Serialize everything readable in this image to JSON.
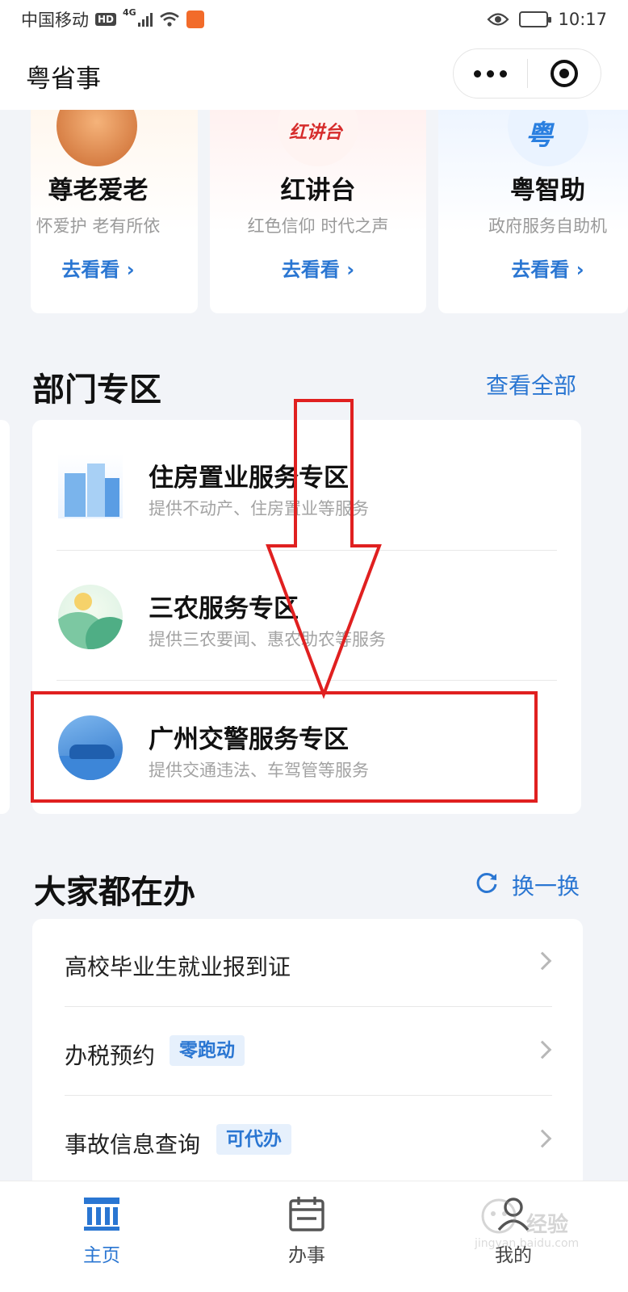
{
  "status_bar": {
    "carrier": "中国移动",
    "hd_badge": "HD",
    "network": "4G",
    "time": "10:17"
  },
  "app": {
    "title": "粤省事"
  },
  "feature_cards": [
    {
      "title": "尊老爱老",
      "subtitle": "怀爱护 老有所依",
      "link": "去看看 ›"
    },
    {
      "title": "红讲台",
      "subtitle": "红色信仰 时代之声",
      "link": "去看看 ›",
      "logo_text": "红讲台"
    },
    {
      "title": "粤智助",
      "subtitle": "政府服务自助机",
      "link": "去看看 ›",
      "logo_text": "粤"
    }
  ],
  "department": {
    "title": "部门专区",
    "view_all": "查看全部",
    "items": [
      {
        "title": "住房置业服务专区",
        "subtitle": "提供不动产、住房置业等服务",
        "icon": "house-building-icon"
      },
      {
        "title": "三农服务专区",
        "subtitle": "提供三农要闻、惠农助农等服务",
        "icon": "farm-landscape-icon"
      },
      {
        "title": "广州交警服务专区",
        "subtitle": "提供交通违法、车驾管等服务",
        "icon": "traffic-police-icon"
      }
    ]
  },
  "popular": {
    "title": "大家都在办",
    "refresh": "换一换",
    "items": [
      {
        "label": "高校毕业生就业报到证",
        "tag": ""
      },
      {
        "label": "办税预约",
        "tag": "零跑动"
      },
      {
        "label": "事故信息查询",
        "tag": "可代办"
      }
    ]
  },
  "bottom_nav": {
    "items": [
      {
        "label": "主页",
        "active": true
      },
      {
        "label": "办事",
        "active": false
      },
      {
        "label": "我的",
        "active": false
      }
    ]
  },
  "watermark": {
    "text": "经验",
    "sub": "jingyan.baidu.com"
  },
  "colors": {
    "accent": "#2a76d2",
    "annotation_red": "#e02020",
    "background": "#f2f4f8"
  }
}
